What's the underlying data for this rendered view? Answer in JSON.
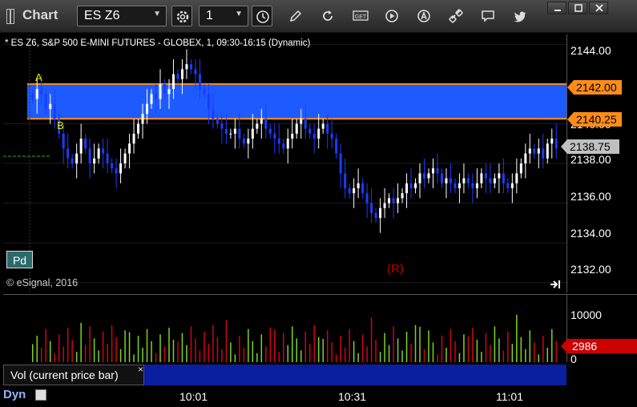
{
  "app": {
    "title": "Chart"
  },
  "toolbar": {
    "symbol": "ES Z6",
    "interval": "1",
    "icons": [
      "gear-icon",
      "clock-icon",
      "pencil-icon",
      "refresh-icon",
      "get-icon",
      "play-icon",
      "alert-icon",
      "link-icon",
      "comment-icon",
      "twitter-icon"
    ],
    "get_label": "GET"
  },
  "window": {
    "buttons": [
      "minimize",
      "maximize",
      "close"
    ]
  },
  "chart": {
    "header": "* ES Z6, S&P 500 E-MINI FUTURES - GLOBEX, 1, 09:30-16:15 (Dynamic)",
    "watermark": "© eSignal, 2016",
    "r_marker": "(R)",
    "pd_label": "Pd",
    "zone_labels": {
      "a": "A",
      "b": "B"
    },
    "colors": {
      "zone": "#1e5bff",
      "zone_line": "#ff8c1a",
      "up": "#ffffff",
      "down": "#1a3cff",
      "counter": "#22c422",
      "volume_up": "#7ed321",
      "volume_down": "#d0021b",
      "current_price_bg": "#c0c0c0",
      "volume_label_bg": "#cc0000"
    }
  },
  "price_axis": {
    "ticks": [
      "2144.00",
      "2140.00",
      "2138.00",
      "2136.00",
      "2134.00",
      "2132.00"
    ],
    "labels": {
      "zone_top": "2142.00",
      "zone_bottom": "2140.25",
      "current": "2138.75"
    }
  },
  "volume": {
    "panel_label": "Vol (current price bar)",
    "close_symbol": "×",
    "axis_ticks": [
      "10000",
      "0"
    ],
    "current": "2986"
  },
  "time_axis": {
    "labels": [
      "10:01",
      "10:31",
      "11:01"
    ]
  },
  "footer": {
    "mode": "Dyn"
  },
  "chart_data": {
    "type": "candlestick",
    "symbol": "ES Z6",
    "interval": "1",
    "y_range": [
      2131.5,
      2144.5
    ],
    "y_ticks": [
      2144.0,
      2140.0,
      2138.0,
      2136.0,
      2134.0,
      2132.0
    ],
    "zone": {
      "top": 2142.0,
      "bottom": 2140.25,
      "top_label": "A",
      "bottom_label": "B"
    },
    "last_price": 2138.75,
    "x_labels": [
      "10:01",
      "10:31",
      "11:01"
    ],
    "closes": [
      2141.25,
      2141.75,
      2141.5,
      2140.75,
      2141.0,
      2140.25,
      2139.5,
      2138.75,
      2138.25,
      2138.0,
      2138.5,
      2139.25,
      2138.75,
      2138.0,
      2138.25,
      2138.75,
      2138.5,
      2138.0,
      2137.75,
      2137.5,
      2138.0,
      2138.5,
      2139.0,
      2139.5,
      2140.0,
      2140.5,
      2141.0,
      2141.5,
      2141.25,
      2142.0,
      2141.5,
      2141.75,
      2142.5,
      2142.25,
      2142.75,
      2143.0,
      2142.75,
      2142.5,
      2141.75,
      2141.5,
      2140.75,
      2140.25,
      2140.0,
      2139.75,
      2139.5,
      2139.5,
      2139.75,
      2139.25,
      2139.0,
      2139.25,
      2139.75,
      2140.0,
      2140.25,
      2139.75,
      2139.5,
      2139.25,
      2139.0,
      2138.75,
      2139.25,
      2139.5,
      2140.0,
      2140.25,
      2139.75,
      2139.5,
      2139.25,
      2139.75,
      2140.0,
      2139.5,
      2139.25,
      2138.5,
      2137.5,
      2136.75,
      2136.5,
      2136.75,
      2137.0,
      2136.5,
      2136.0,
      2135.5,
      2135.25,
      2135.75,
      2136.0,
      2136.25,
      2136.0,
      2136.25,
      2136.5,
      2137.0,
      2136.75,
      2137.0,
      2137.5,
      2137.25,
      2137.5,
      2137.75,
      2137.5,
      2137.0,
      2137.25,
      2137.0,
      2136.75,
      2137.0,
      2137.25,
      2137.0,
      2136.75,
      2137.0,
      2137.5,
      2137.25,
      2137.0,
      2137.25,
      2137.5,
      2137.0,
      2136.75,
      2137.0,
      2137.5,
      2138.0,
      2138.5,
      2138.75,
      2138.5,
      2138.75,
      2138.25,
      2139.0,
      2139.25,
      2138.75
    ],
    "volume_max": 12000,
    "volume_current": 2986
  }
}
